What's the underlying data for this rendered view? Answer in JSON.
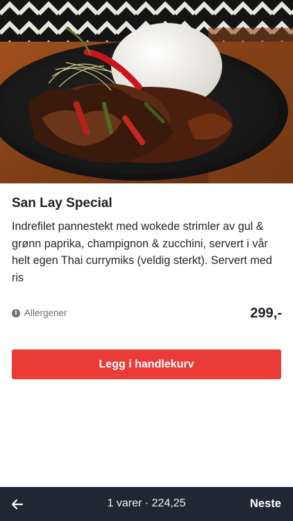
{
  "product": {
    "image_description_icon": "dish-photo",
    "title": "San Lay Special",
    "description": "Indrefilet pannestekt med wokede strimler av gul & grønn paprika, champignon & zucchini, servert i vår helt egen Thai currymiks (veldig sterkt). Servert med ris",
    "allergens_label": "Allergener",
    "allergens_icon": "info-icon",
    "price": "299,-"
  },
  "actions": {
    "add_to_cart_label": "Legg i handlekurv",
    "accent_color": "#ea3b38"
  },
  "bottom_bar": {
    "back_icon": "arrow-left-icon",
    "cart_summary": "1 varer · 224,25",
    "next_label": "Neste",
    "background_color": "#1f2735"
  }
}
